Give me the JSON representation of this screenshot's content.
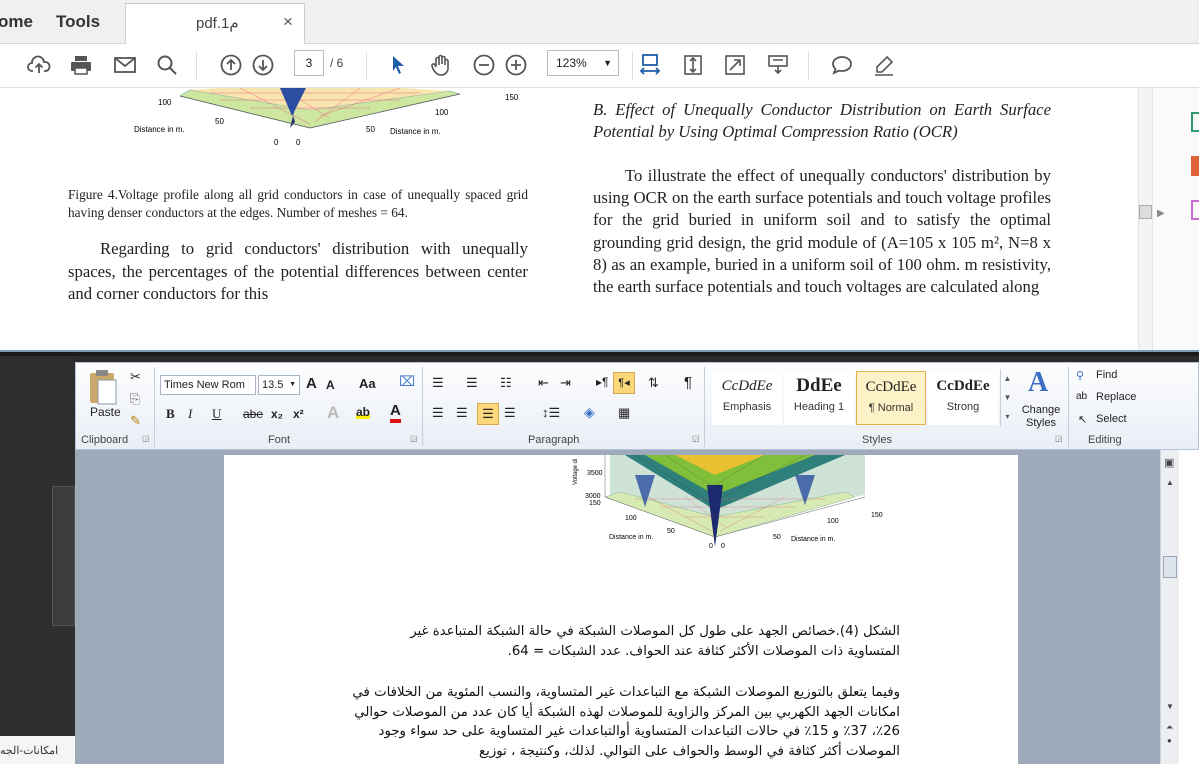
{
  "pdf_viewer": {
    "menu": [
      "ome",
      "Tools"
    ],
    "tab_title": "pdf.1م",
    "tab_close": "×",
    "toolbar": {
      "page_current": "3",
      "page_total": "/ 6",
      "zoom": "123%",
      "icons": [
        "upload-cloud-icon",
        "print-icon",
        "mail-icon",
        "search-icon",
        "page-up-icon",
        "page-down-icon",
        "select-arrow-icon",
        "hand-icon",
        "zoom-out-icon",
        "zoom-in-icon",
        "fit-width-icon",
        "fit-page-icon",
        "fullscreen-icon",
        "read-mode-icon",
        "comment-icon",
        "pen-icon"
      ]
    },
    "figure_labels": {
      "y100": "100",
      "y50": "50",
      "left_axis": "Distance in m.",
      "zero_a": "0",
      "zero_b": "0",
      "x50": "50",
      "x100": "100",
      "x150": "150",
      "right_axis": "Distance in m."
    },
    "caption": "Figure 4.Voltage profile along all grid conductors in case of unequally spaced grid having denser conductors at the edges. Number of meshes = 64.",
    "left_paragraph": "Regarding to grid conductors' distribution with unequally spaces, the percentages of the potential differences between center and corner conductors for this",
    "section_heading": "B.  Effect of Unequally Conductor Distribution on Earth Surface Potential by Using Optimal Compression Ratio (OCR)",
    "right_paragraph": "To illustrate the effect of unequally conductors' distribution by using OCR on the earth surface potentials and touch voltage profiles for the grid buried in uniform soil and to satisfy the optimal grounding grid design, the grid module of (A=105 x 105 m², N=8 x 8) as an example, buried in a uniform soil of 100 ohm. m resistivity, the earth surface potentials and touch voltages are calculated along"
  },
  "word": {
    "taskbar_label": "امكانات-الجه",
    "clipboard": {
      "label": "Clipboard",
      "paste": "Paste"
    },
    "font": {
      "label": "Font",
      "family": "Times New Rom",
      "size": "13.5",
      "bold": "B",
      "italic": "I",
      "underline": "U",
      "strike": "abe",
      "sub": "x₂",
      "sup": "x²",
      "grow": "A",
      "shrink": "A",
      "case": "Aa",
      "highlight": "ab",
      "color": "A"
    },
    "paragraph": {
      "label": "Paragraph",
      "pilcrow": "¶"
    },
    "styles": {
      "label": "Styles",
      "items": [
        {
          "sample": "CcDdEe",
          "name": "Emphasis"
        },
        {
          "sample": "DdEe",
          "name": "Heading 1"
        },
        {
          "sample": "CcDdEe",
          "name": "¶ Normal"
        },
        {
          "sample": "CcDdEe",
          "name": "Strong"
        }
      ],
      "change_styles": "Change Styles"
    },
    "editing": {
      "label": "Editing",
      "find": "Find",
      "replace": "Replace",
      "select": "Select"
    },
    "figure_labels": {
      "z3500": "3500",
      "z3000": "3000",
      "y150": "150",
      "y100": "100",
      "y50": "50",
      "left_axis": "Distance in m.",
      "zero_a": "0",
      "zero_b": "0",
      "x50": "50",
      "x100": "100",
      "x150": "150",
      "right_axis": "Distance in m.",
      "zlabel": "Voltage di"
    },
    "arabic_caption": "الشكل (4).خصائص الجهد على طول كل الموصلات الشبكة في حالة الشبكة المتباعدة غير المتساوية ذات الموصلات الأكثر كثافة عند الحواف. عدد الشبكات = 64.",
    "arabic_paragraph": "وفيما يتعلق بالتوزيع الموصلات الشبكة مع التباعدات غير المتساوية، والنسب المئوية من الخلافات في امكانات الجهد الكهربي بين المركز والزاوية للموصلات لهذه الشبكة أيا كان عدد من الموصلات حوالي 26٪، 37٪ و 15٪ في حالات التباعدات المتساوية أوالتباعدات غير المتساوية على حد سواء وجود الموصلات أكثر كثافة في الوسط والحواف على التوالي. لذلك، وكنتيجة ، توزيع"
  }
}
